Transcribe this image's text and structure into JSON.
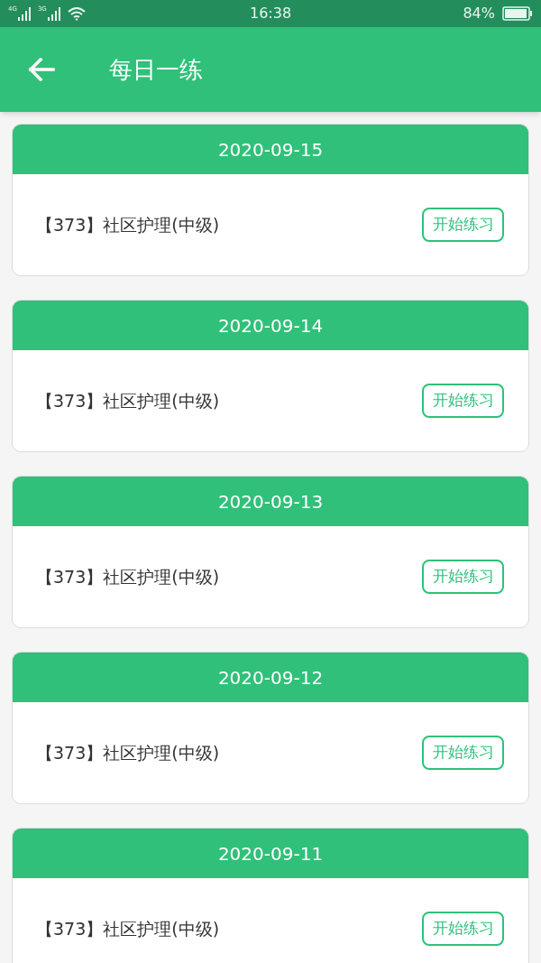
{
  "status_bar": {
    "network_1": "4G",
    "network_2": "3G",
    "time": "16:38",
    "battery": "84%"
  },
  "header": {
    "title": "每日一练"
  },
  "cards": [
    {
      "date": "2020-09-15",
      "subject": "【373】社区护理(中级)",
      "button": "开始练习"
    },
    {
      "date": "2020-09-14",
      "subject": "【373】社区护理(中级)",
      "button": "开始练习"
    },
    {
      "date": "2020-09-13",
      "subject": "【373】社区护理(中级)",
      "button": "开始练习"
    },
    {
      "date": "2020-09-12",
      "subject": "【373】社区护理(中级)",
      "button": "开始练习"
    },
    {
      "date": "2020-09-11",
      "subject": "【373】社区护理(中级)",
      "button": "开始练习"
    }
  ]
}
